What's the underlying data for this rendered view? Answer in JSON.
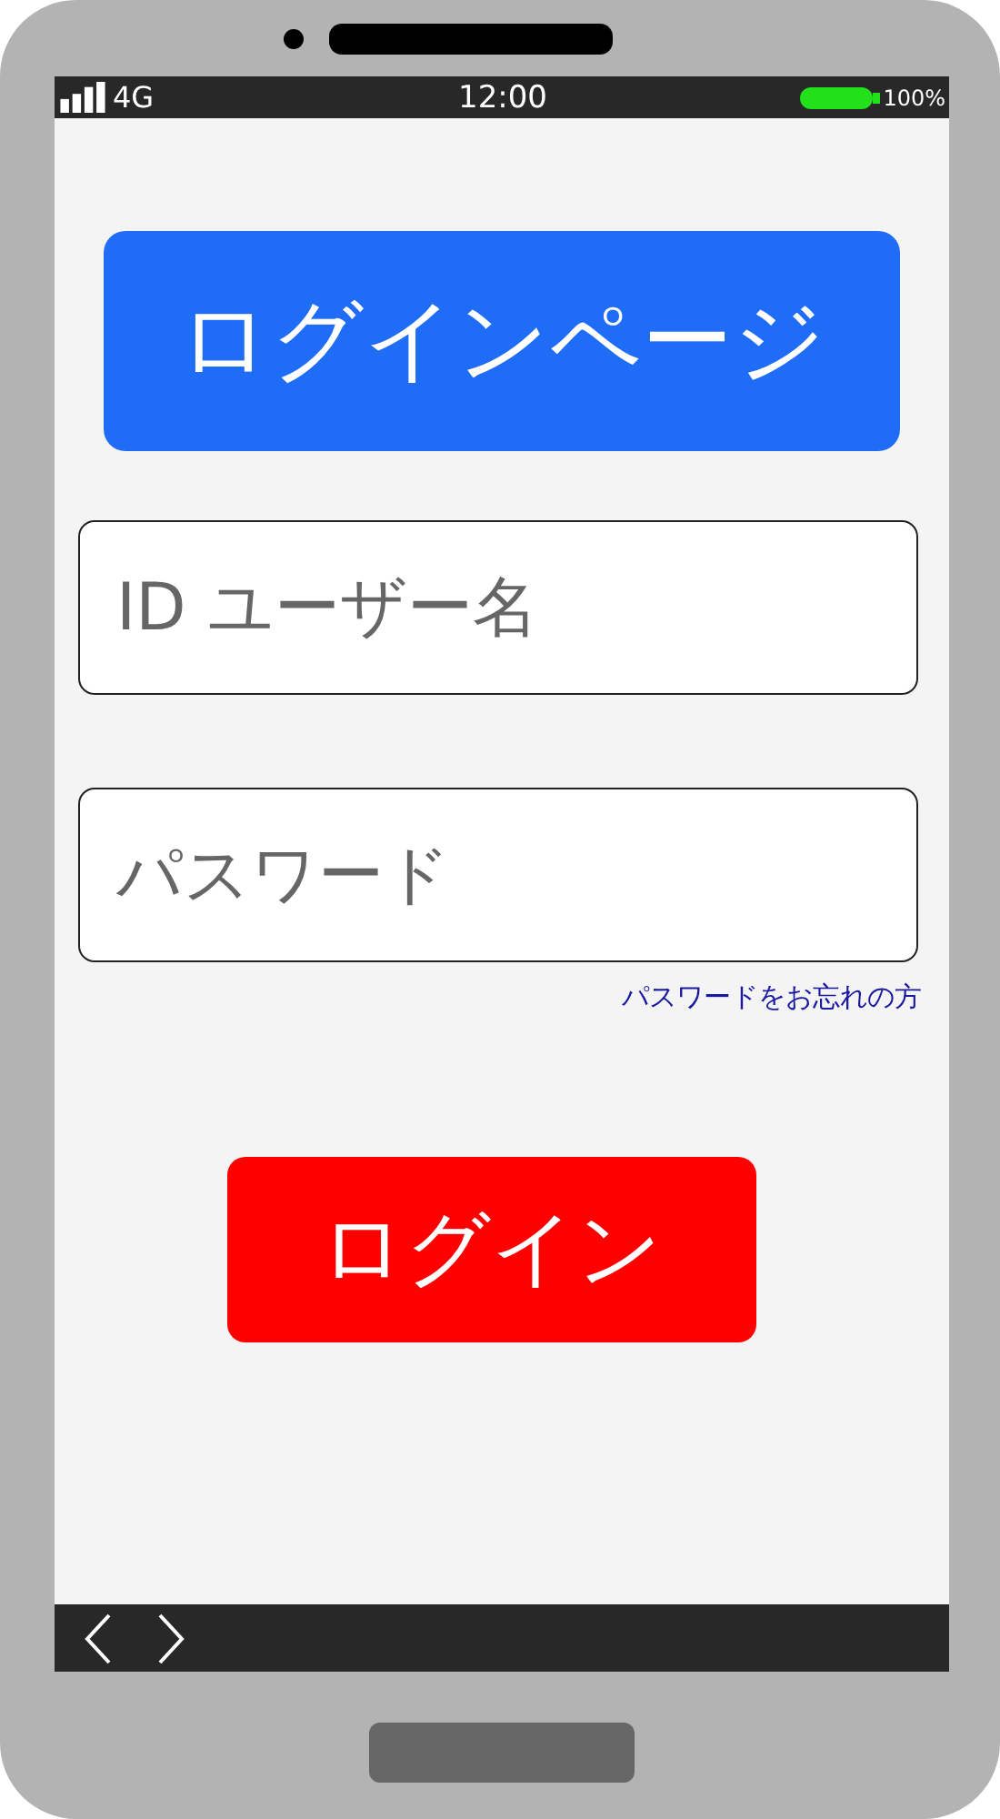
{
  "status_bar": {
    "network": "4G",
    "time": "12:00",
    "battery": "100%"
  },
  "header": {
    "title": "ログインページ"
  },
  "username_field": {
    "placeholder": "ID ユーザー名"
  },
  "password_field": {
    "placeholder": "パスワード"
  },
  "forgot_link": "パスワードをお忘れの方",
  "login_button": "ログイン"
}
